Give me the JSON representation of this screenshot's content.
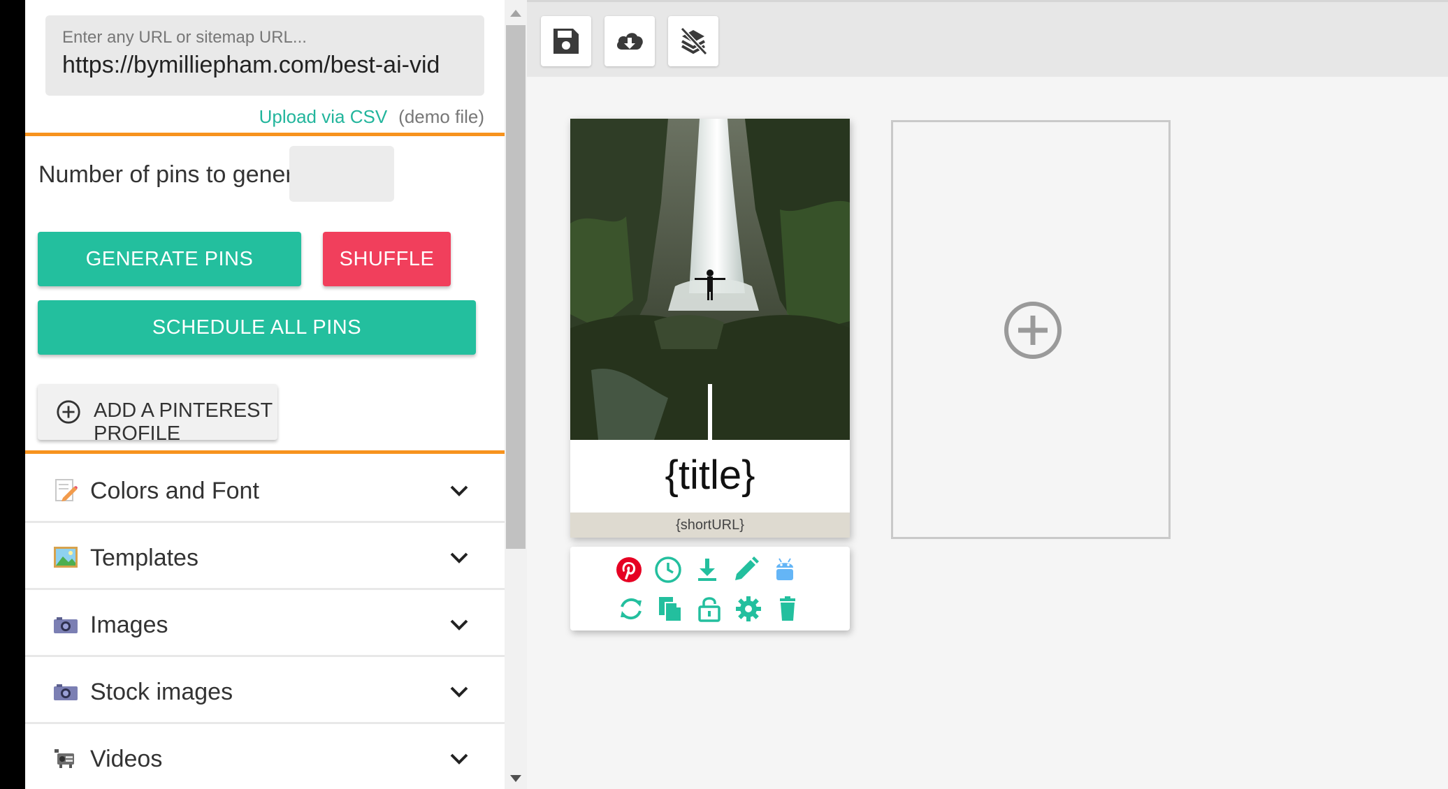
{
  "url_input": {
    "placeholder": "Enter any URL or sitemap URL...",
    "value": "https://bymilliepham.com/best-ai-vid"
  },
  "upload": {
    "link_label": "Upload via CSV",
    "demo_label": "(demo file)"
  },
  "generator": {
    "pins_label": "Number of pins to generate",
    "pins_value": "",
    "generate_label": "GENERATE PINS",
    "shuffle_label": "SHUFFLE",
    "schedule_label": "SCHEDULE ALL PINS",
    "add_profile_label": "ADD A PINTEREST PROFILE"
  },
  "accordion": [
    {
      "label": "Colors and Font",
      "icon": "memo-icon"
    },
    {
      "label": "Templates",
      "icon": "picture-icon"
    },
    {
      "label": "Images",
      "icon": "camera-icon"
    },
    {
      "label": "Stock images",
      "icon": "camera-icon"
    },
    {
      "label": "Videos",
      "icon": "projector-icon"
    }
  ],
  "toolbar": {
    "icons": [
      "save-icon",
      "cloud-download-icon",
      "hide-layers-icon"
    ]
  },
  "pin": {
    "title": "{title}",
    "short_url": "{shortURL}",
    "actions": [
      "pinterest-icon",
      "clock-icon",
      "download-icon",
      "pencil-icon",
      "android-icon",
      "refresh-icon",
      "copy-icon",
      "lock-icon",
      "gear-icon",
      "trash-icon"
    ]
  },
  "colors": {
    "accent": "#23bf9e",
    "danger": "#f13f5c",
    "highlight": "#f7931e",
    "pinterest": "#e60023"
  }
}
